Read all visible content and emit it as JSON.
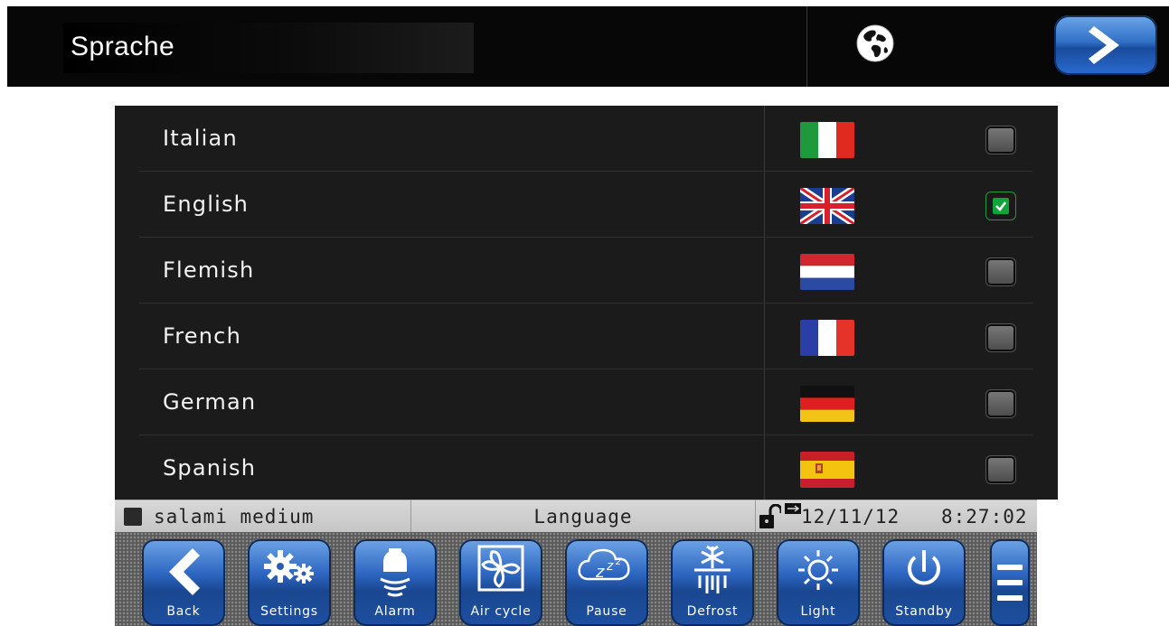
{
  "header": {
    "title": "Sprache",
    "globe_icon": "globe-icon",
    "next_icon": "chevron-right-icon"
  },
  "languages": [
    {
      "label": "Italian",
      "flag": "italy-flag",
      "checked": false
    },
    {
      "label": "English",
      "flag": "uk-flag",
      "checked": true
    },
    {
      "label": "Flemish",
      "flag": "netherlands-flag",
      "checked": false
    },
    {
      "label": "French",
      "flag": "france-flag",
      "checked": false
    },
    {
      "label": "German",
      "flag": "germany-flag",
      "checked": false
    },
    {
      "label": "Spanish",
      "flag": "spain-flag",
      "checked": false
    }
  ],
  "status": {
    "product": "salami medium",
    "screen": "Language",
    "date": "12/11/12",
    "time": "8:27:02"
  },
  "toolbar": {
    "buttons": [
      {
        "label": "Back",
        "icon": "back-arrow-icon"
      },
      {
        "label": "Settings",
        "icon": "gears-icon"
      },
      {
        "label": "Alarm",
        "icon": "bell-icon"
      },
      {
        "label": "Air cycle",
        "icon": "fan-icon"
      },
      {
        "label": "Pause",
        "icon": "zzz-cloud-icon"
      },
      {
        "label": "Defrost",
        "icon": "snowflake-icon"
      },
      {
        "label": "Light",
        "icon": "sun-icon"
      },
      {
        "label": "Standby",
        "icon": "power-icon"
      }
    ],
    "menu_icon": "menu-icon"
  },
  "colors": {
    "accent_blue": "#2d66c1",
    "checked_green": "#11a43b",
    "panel_bg": "#1b1b1b",
    "status_bar": "#d0d0d0"
  }
}
